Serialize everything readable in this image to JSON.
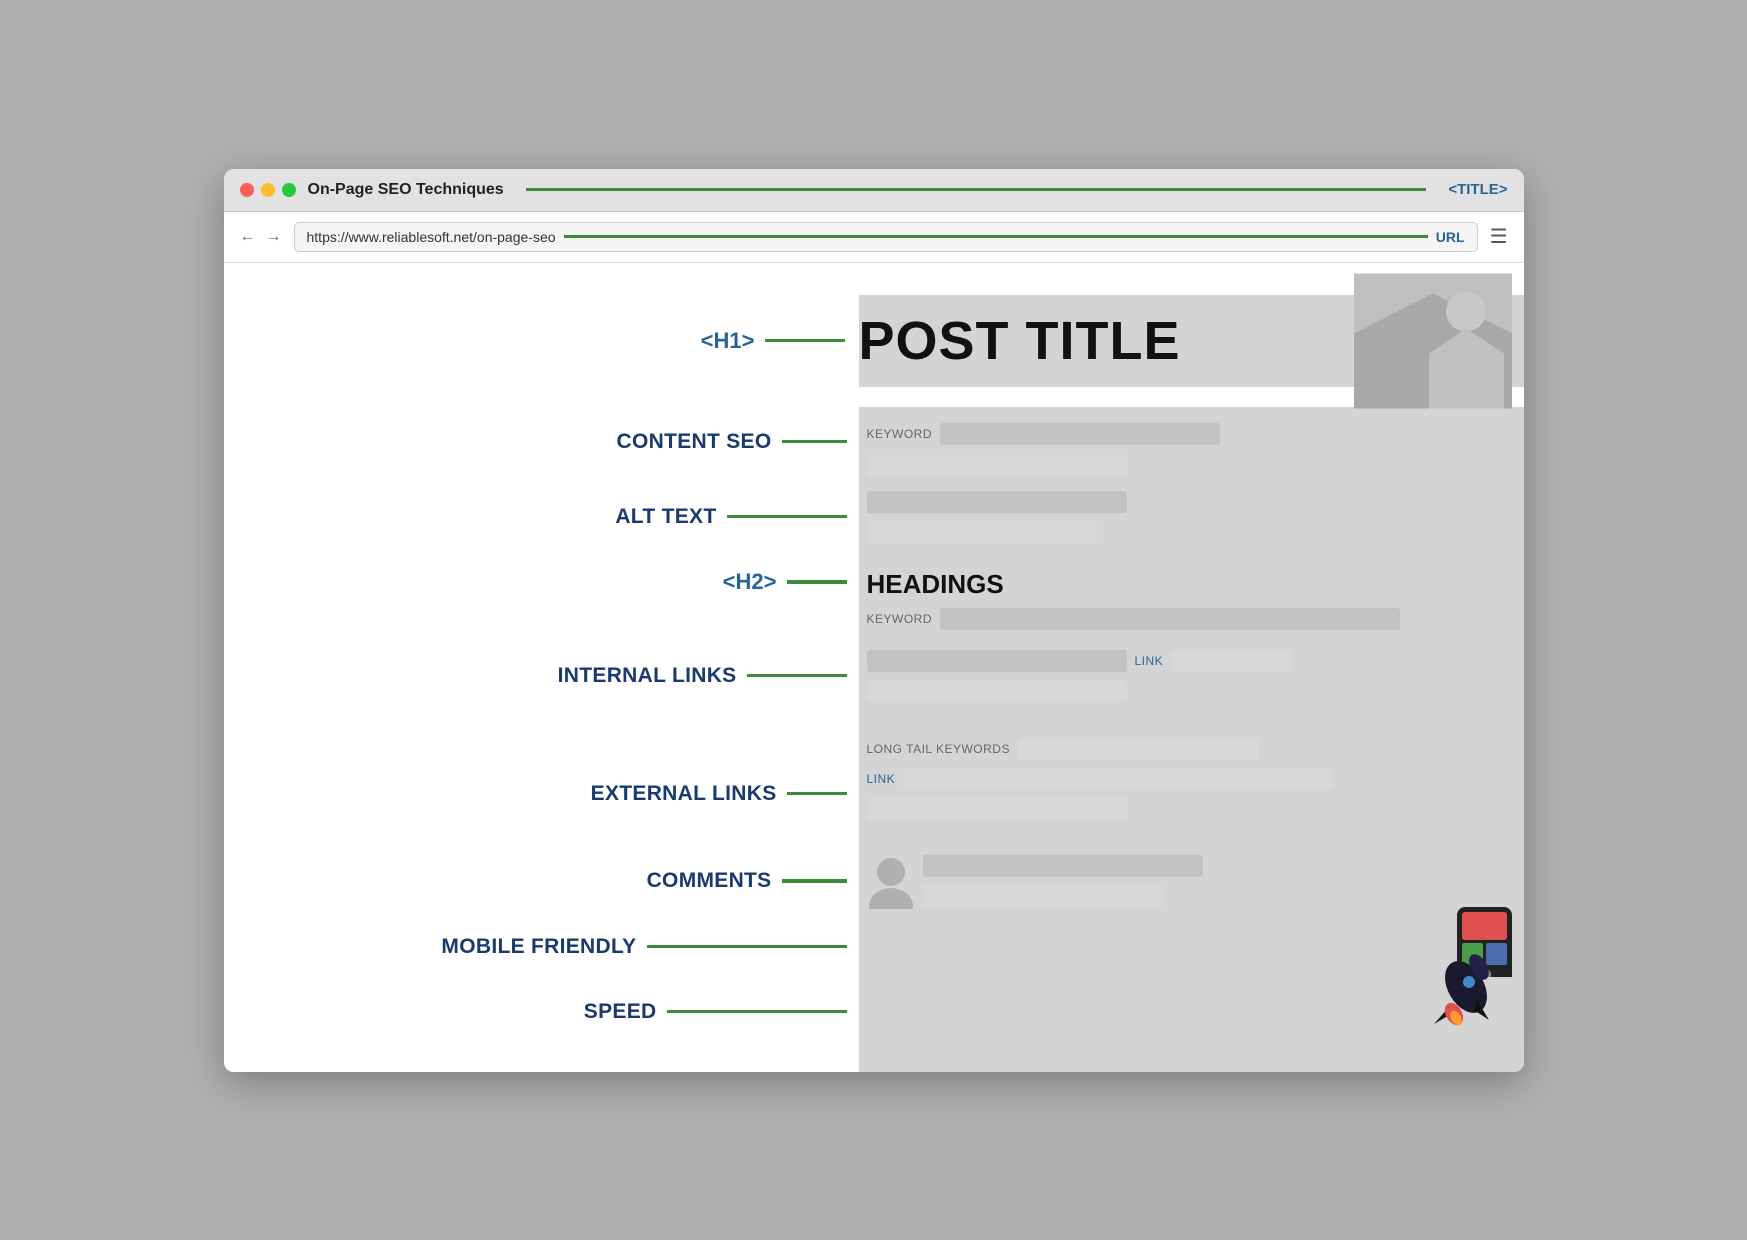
{
  "browser": {
    "title": "On-Page SEO Techniques",
    "title_tag": "<TITLE>",
    "url": "https://www.reliablesoft.net/on-page-seo",
    "url_label": "URL"
  },
  "page": {
    "h1_label": "<H1>",
    "post_title": "POST TITLE",
    "h2_label": "<H2>",
    "h2_content": "HEADINGS"
  },
  "seo_items": [
    {
      "id": "content-seo",
      "label": "CONTENT SEO",
      "line_width": 60
    },
    {
      "id": "alt-text",
      "label": "ALT TEXT",
      "line_width": 120
    },
    {
      "id": "h2",
      "label": "",
      "line_width": 60
    },
    {
      "id": "internal-links",
      "label": "INTERNAL LINKS",
      "line_width": 120
    },
    {
      "id": "external-links",
      "label": "EXTERNAL LINKS",
      "line_width": 60
    },
    {
      "id": "comments",
      "label": "COMMENTS",
      "line_width": 60
    },
    {
      "id": "mobile-friendly",
      "label": "MOBILE FRIENDLY",
      "line_width": 200
    },
    {
      "id": "speed",
      "label": "SPEED",
      "line_width": 180
    }
  ],
  "labels": {
    "keyword": "KEYWORD",
    "keyword2": "KEYWORD",
    "link": "LINK",
    "link2": "LINK",
    "long_tail": "LONG TAIL KEYWORDS"
  },
  "colors": {
    "green": "#3a8a3a",
    "blue_label": "#1a3a6e",
    "blue_link": "#2a6496"
  }
}
